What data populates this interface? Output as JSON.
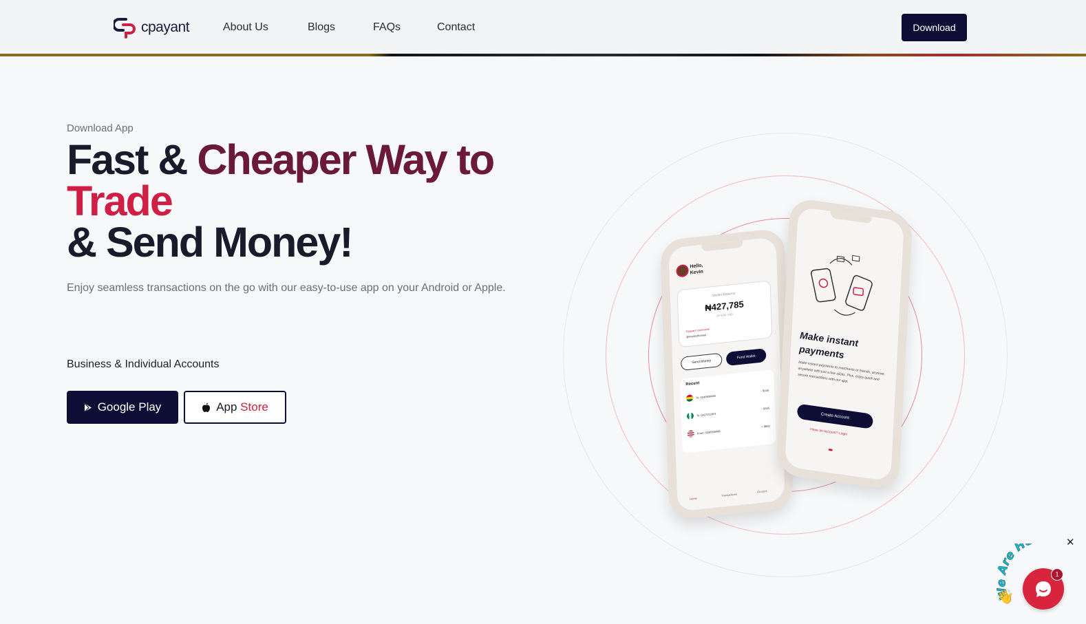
{
  "header": {
    "logo_text": "cpayant",
    "nav": [
      "About Us",
      "Blogs",
      "FAQs",
      "Contact"
    ],
    "download_label": "Download"
  },
  "hero": {
    "eyebrow": "Download App",
    "headline": {
      "part1": "Fast & ",
      "part2": "Cheaper Way to",
      "part3": "Trade",
      "part4": "& Send Money!"
    },
    "subtext": "Enjoy seamless transactions on the go with our easy-to-use app on your Android or Apple.",
    "accounts_label": "Business & Individual Accounts",
    "google_play_label": "Google Play",
    "app_store_label_a": "App",
    "app_store_label_b": "Store"
  },
  "phone_left": {
    "greeting": "Hello,",
    "name": "Kevin",
    "balance_label": "Wallet Balance",
    "balance": "₦427,785",
    "balance_sub": "1075.66 USD",
    "tag_label": "Cpayant Username",
    "tag_value": "@marleythomas",
    "send_money": "Send Money",
    "fund_wallet": "Fund Wallet",
    "recent": "Recent",
    "rows": [
      {
        "text": "To: 0240908488",
        "amount": "- $345"
      },
      {
        "text": "To: 0437212801",
        "amount": "- $345"
      },
      {
        "text": "From: 0240908488",
        "amount": "+ $862"
      }
    ],
    "tabs": [
      "Home",
      "Transactions",
      "Account"
    ]
  },
  "phone_right": {
    "title": "Make instant payments",
    "body": "Make instant payments to merchants or friends, anytime, anywhere with just a few clicks. Plus, enjoy quick and secure transactions with our app.",
    "cta": "Create Account",
    "login": "Have an account? Login"
  },
  "chat": {
    "badge": "1",
    "arc_text": "We Are Here!"
  },
  "colors": {
    "navy": "#0e0d35",
    "brand_red": "#d01f45",
    "maroon": "#6a1a36"
  }
}
